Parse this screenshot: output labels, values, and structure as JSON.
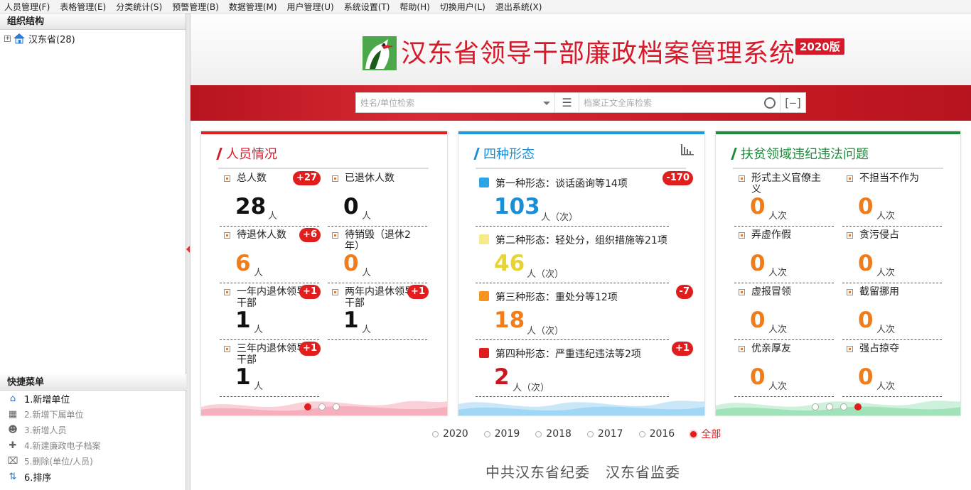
{
  "menu": [
    "人员管理(F)",
    "表格管理(E)",
    "分类统计(S)",
    "预警管理(B)",
    "数据管理(M)",
    "用户管理(U)",
    "系统设置(T)",
    "帮助(H)",
    "切换用户(L)",
    "退出系统(X)"
  ],
  "left": {
    "org_title": "组织结构",
    "tree_root": "汉东省(28)",
    "quick_title": "快捷菜单",
    "quick_items": [
      {
        "label": "1.新增单位",
        "icon": "home-add-icon",
        "enabled": true
      },
      {
        "label": "2.新增下属单位",
        "icon": "org-add-icon",
        "enabled": false
      },
      {
        "label": "3.新增人员",
        "icon": "person-add-icon",
        "enabled": false
      },
      {
        "label": "4.新建廉政电子档案",
        "icon": "plus-box-icon",
        "enabled": false
      },
      {
        "label": "5.删除(单位/人员)",
        "icon": "delete-icon",
        "enabled": false
      },
      {
        "label": "6.排序",
        "icon": "sort-icon",
        "enabled": true
      }
    ]
  },
  "header": {
    "title": "汉东省领导干部廉政档案管理系统",
    "version": "2020版",
    "search_name_placeholder": "姓名/单位检索",
    "search_fulltext_placeholder": "档案正文全库检索"
  },
  "colors": {
    "red": "#e01e1e",
    "blue": "#1a8fd8",
    "green": "#1c8c3c",
    "orange": "#f07d1a",
    "yellow": "#e8d431",
    "darkred": "#c8161e"
  },
  "card1": {
    "title": "人员情况",
    "items": [
      {
        "label": "总人数",
        "value": "28",
        "unit": "人",
        "badge": "+27",
        "color": "#111"
      },
      {
        "label": "已退休人数",
        "value": "0",
        "unit": "人",
        "badge": "",
        "color": "#111"
      },
      {
        "label": "待退休人数",
        "value": "6",
        "unit": "人",
        "badge": "+6",
        "color": "#f07d1a"
      },
      {
        "label": "待销毁（退休2年）",
        "value": "0",
        "unit": "人",
        "badge": "",
        "color": "#f07d1a"
      },
      {
        "label": "一年内退休领导干部",
        "value": "1",
        "unit": "人",
        "badge": "+1",
        "color": "#111"
      },
      {
        "label": "两年内退休领导干部",
        "value": "1",
        "unit": "人",
        "badge": "+1",
        "color": "#111"
      },
      {
        "label": "三年内退休领导干部",
        "value": "1",
        "unit": "人",
        "badge": "+1",
        "color": "#111"
      }
    ],
    "page_active": 0,
    "pages": 3
  },
  "card2": {
    "title": "四种形态",
    "chart_icon": "bar-chart-icon",
    "items": [
      {
        "label": "第一种形态：谈话函询等14项",
        "value": "103",
        "unit": "人（次）",
        "badge": "-170",
        "color": "#1a8fd8",
        "square": "#2aa6e8"
      },
      {
        "label": "第二种形态：轻处分，组织措施等21项",
        "value": "46",
        "unit": "人（次）",
        "badge": "",
        "color": "#e8d431",
        "square": "#f6ea8a"
      },
      {
        "label": "第三种形态：重处分等12项",
        "value": "18",
        "unit": "人（次）",
        "badge": "-7",
        "color": "#f07d1a",
        "square": "#f7931e"
      },
      {
        "label": "第四种形态：严重违纪违法等2项",
        "value": "2",
        "unit": "人（次）",
        "badge": "+1",
        "color": "#c8161e",
        "square": "#e01e1e"
      }
    ]
  },
  "card3": {
    "title": "扶贫领域违纪违法问题",
    "items": [
      {
        "label": "形式主义官僚主义",
        "value": "0",
        "unit": "人次"
      },
      {
        "label": "不担当不作为",
        "value": "0",
        "unit": "人次"
      },
      {
        "label": "弄虚作假",
        "value": "0",
        "unit": "人次"
      },
      {
        "label": "贪污侵占",
        "value": "0",
        "unit": "人次"
      },
      {
        "label": "虚报冒领",
        "value": "0",
        "unit": "人次"
      },
      {
        "label": "截留挪用",
        "value": "0",
        "unit": "人次"
      },
      {
        "label": "优亲厚友",
        "value": "0",
        "unit": "人次"
      },
      {
        "label": "强占掠夺",
        "value": "0",
        "unit": "人次"
      }
    ],
    "page_active": 3,
    "pages": 4
  },
  "years": [
    {
      "label": "2020",
      "selected": false
    },
    {
      "label": "2019",
      "selected": false
    },
    {
      "label": "2018",
      "selected": false
    },
    {
      "label": "2017",
      "selected": false
    },
    {
      "label": "2016",
      "selected": false
    },
    {
      "label": "全部",
      "selected": true
    }
  ],
  "footer": [
    "中共汉东省纪委",
    "汉东省监委"
  ]
}
